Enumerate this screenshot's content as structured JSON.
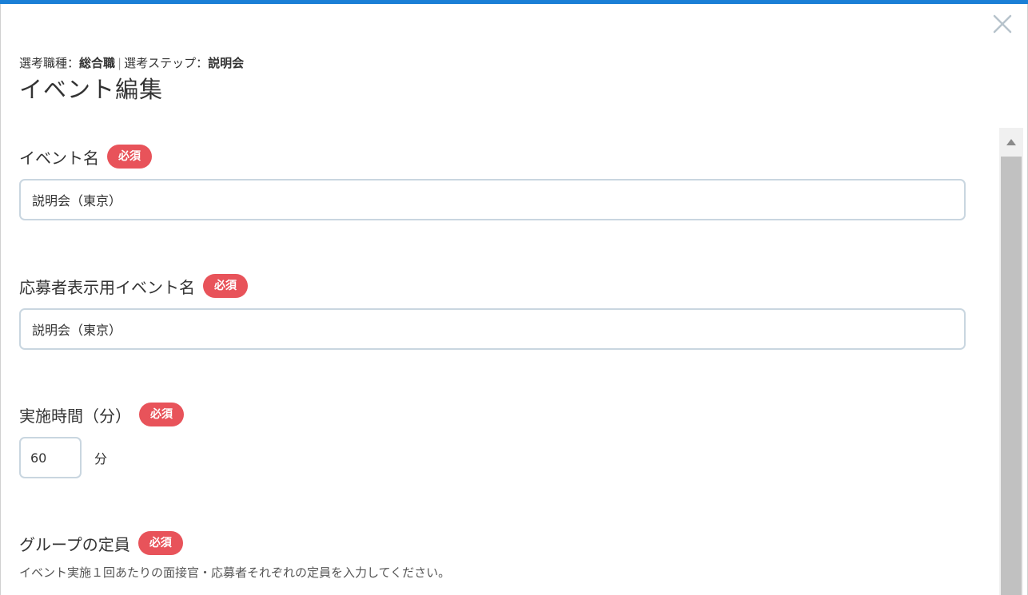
{
  "header": {
    "job_type_label": "選考職種：",
    "job_type_value": "総合職",
    "separator": "|",
    "step_label": "選考ステップ：",
    "step_value": "説明会",
    "title": "イベント編集"
  },
  "fields": {
    "event_name": {
      "label": "イベント名",
      "badge": "必須",
      "value": "説明会（東京）"
    },
    "display_name": {
      "label": "応募者表示用イベント名",
      "badge": "必須",
      "value": "説明会（東京）"
    },
    "duration": {
      "label": "実施時間（分）",
      "badge": "必須",
      "value": "60",
      "unit": "分"
    },
    "capacity": {
      "label": "グループの定員",
      "badge": "必須",
      "help": "イベント実施１回あたりの面接官・応募者それぞれの定員を入力してください。"
    }
  },
  "colors": {
    "accent_bar": "#1a7fd6",
    "required_badge": "#e8535a",
    "input_border": "#c9d6e0"
  },
  "icons": {
    "close": "close-icon",
    "scroll_up": "triangle-up-icon"
  }
}
